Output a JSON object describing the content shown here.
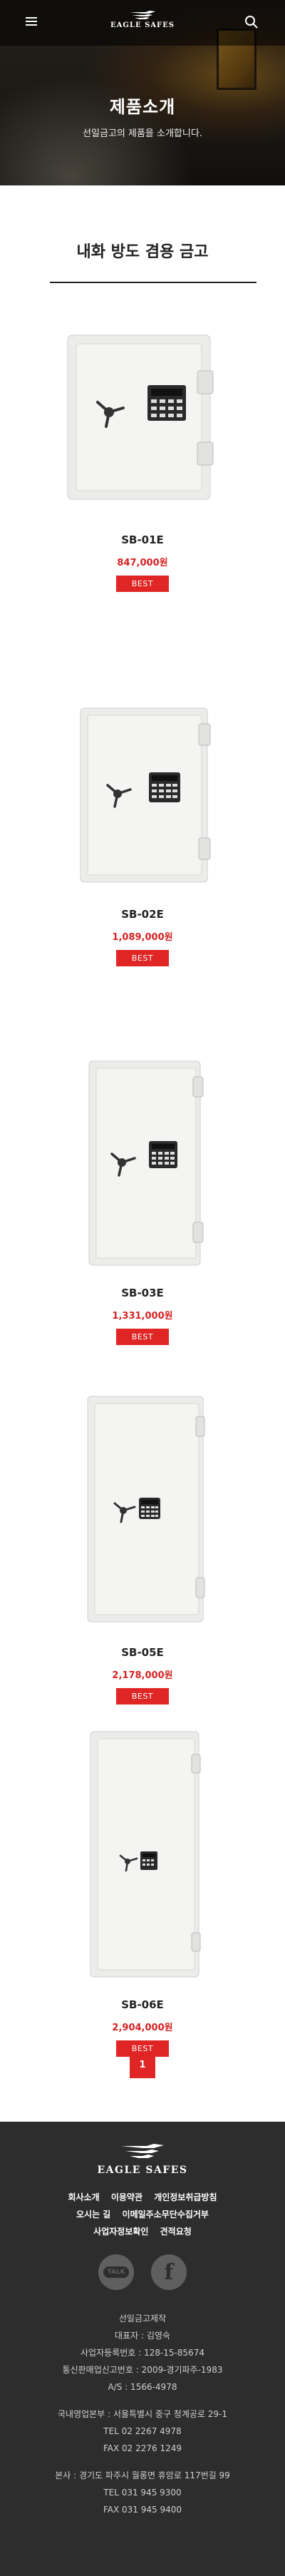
{
  "header": {
    "logo_text": "EAGLE SAFES",
    "menu_icon": "hamburger-menu-icon",
    "search_icon": "search-icon"
  },
  "hero": {
    "title": "제품소개",
    "subtitle": "선일금고의 제품을 소개합니다."
  },
  "section": {
    "title": "내화 방도 겸용 금고"
  },
  "products": [
    {
      "name": "SB-01E",
      "price": "847,000원",
      "badge": "BEST"
    },
    {
      "name": "SB-02E",
      "price": "1,089,000원",
      "badge": "BEST"
    },
    {
      "name": "SB-03E",
      "price": "1,331,000원",
      "badge": "BEST"
    },
    {
      "name": "SB-05E",
      "price": "2,178,000원",
      "badge": "BEST"
    },
    {
      "name": "SB-06E",
      "price": "2,904,000원",
      "badge": "BEST"
    }
  ],
  "pagination": {
    "current": "1"
  },
  "footer": {
    "logo_text": "EAGLE SAFES",
    "links_row1": [
      "회사소개",
      "이용약관",
      "개인정보취급방침"
    ],
    "links_row2": [
      "오시는 길",
      "이메일주소무단수집거부"
    ],
    "links_row3": [
      "사업자정보확인",
      "견적요청"
    ],
    "social": {
      "talk_label": "TALK",
      "facebook_label": "f"
    },
    "info": [
      "선일금고제작",
      "대표자 : 김영숙",
      "사업자등록번호 : 128-15-85674",
      "통신판매업신고번호 : 2009-경기파주-1983",
      "A/S : 1566-4978",
      "",
      "국내영업본부 : 서울특별시 중구 청계공로 29-1",
      "TEL 02 2267 4978",
      "FAX 02 2276 1249",
      "",
      "본사 : 경기도 파주시 월롱면 휴암로 117번길 99",
      "TEL 031 945 9300",
      "FAX 031 945 9400"
    ]
  }
}
